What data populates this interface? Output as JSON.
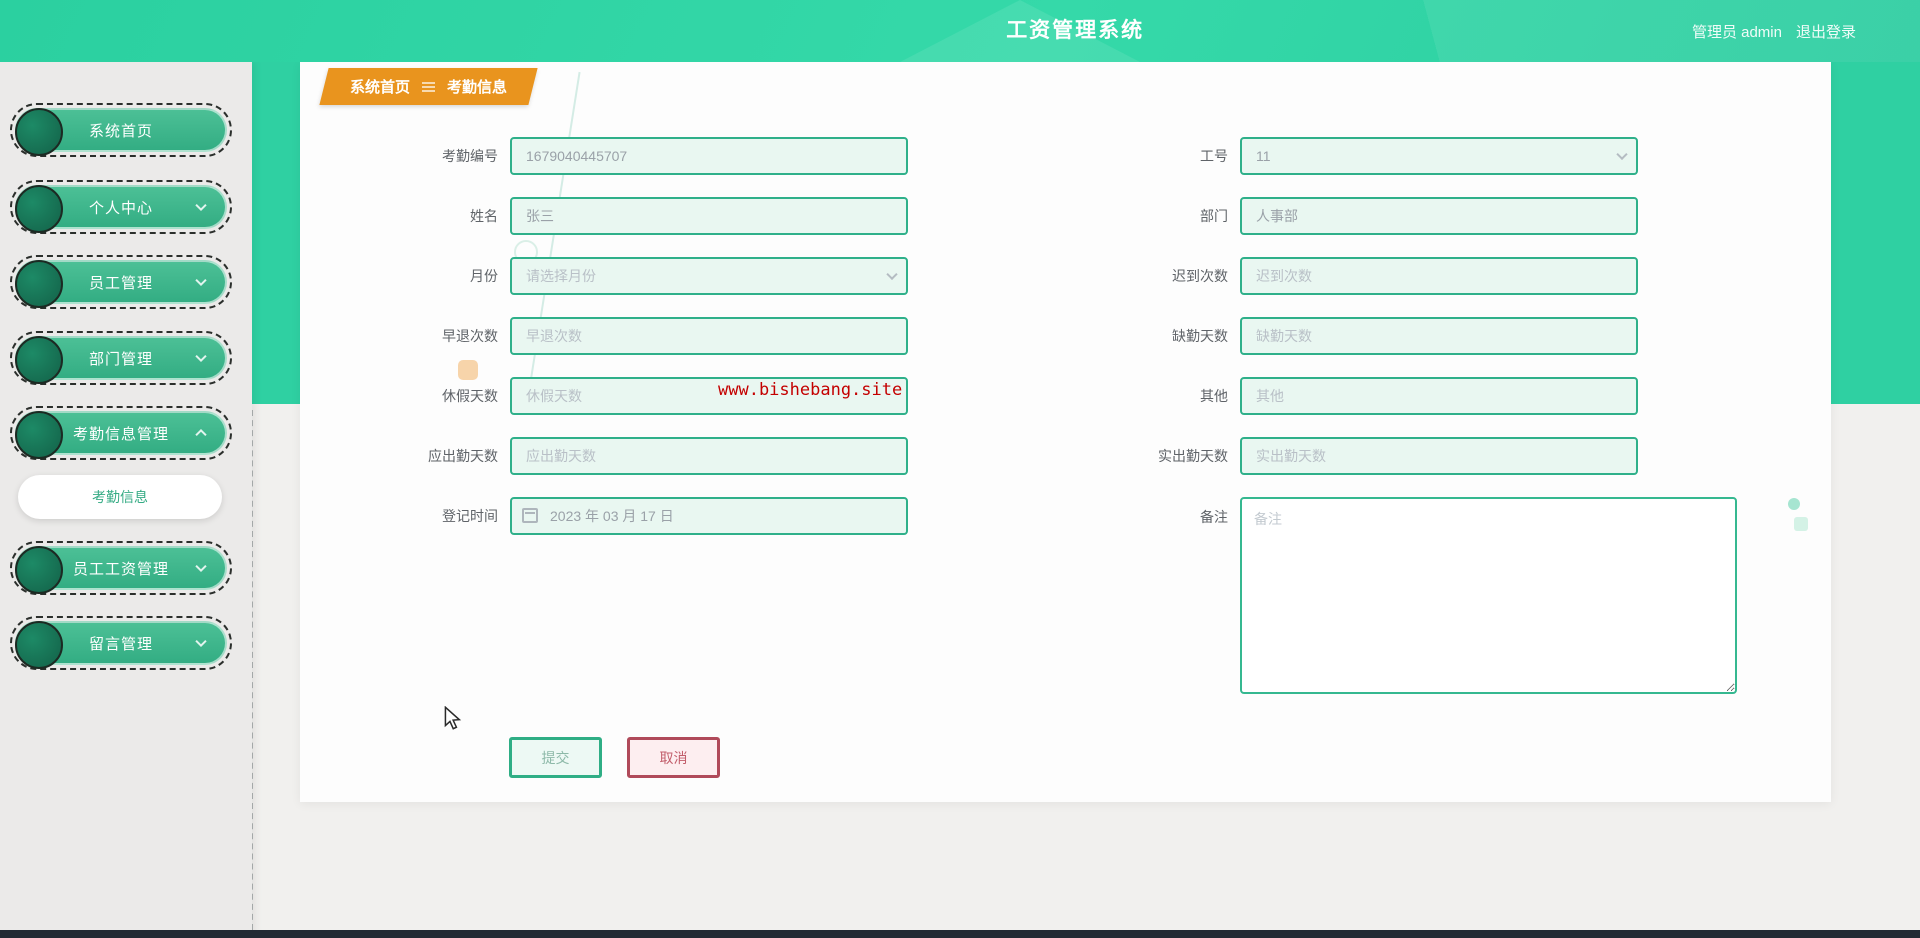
{
  "header": {
    "title": "工资管理系统",
    "user": "管理员 admin",
    "logout": "退出登录"
  },
  "sidebar": {
    "items": [
      {
        "label": "系统首页",
        "chevron": "none"
      },
      {
        "label": "个人中心",
        "chevron": "down"
      },
      {
        "label": "员工管理",
        "chevron": "down"
      },
      {
        "label": "部门管理",
        "chevron": "down"
      },
      {
        "label": "考勤信息管理",
        "chevron": "up",
        "expanded": true
      },
      {
        "label": "员工工资管理",
        "chevron": "down"
      },
      {
        "label": "留言管理",
        "chevron": "down"
      }
    ],
    "submenu": {
      "label": "考勤信息",
      "active": true
    }
  },
  "breadcrumb": {
    "home": "系统首页",
    "current": "考勤信息"
  },
  "form": {
    "left": [
      {
        "label": "考勤编号",
        "value": "1679040445707"
      },
      {
        "label": "姓名",
        "value": "张三"
      },
      {
        "label": "月份",
        "placeholder": "请选择月份",
        "type": "select"
      },
      {
        "label": "早退次数",
        "placeholder": "早退次数"
      },
      {
        "label": "休假天数",
        "placeholder": "休假天数"
      },
      {
        "label": "应出勤天数",
        "placeholder": "应出勤天数"
      },
      {
        "label": "登记时间",
        "value": "2023 年 03 月 17 日",
        "type": "date"
      }
    ],
    "right": [
      {
        "label": "工号",
        "value": "11",
        "type": "select"
      },
      {
        "label": "部门",
        "value": "人事部"
      },
      {
        "label": "迟到次数",
        "placeholder": "迟到次数"
      },
      {
        "label": "缺勤天数",
        "placeholder": "缺勤天数"
      },
      {
        "label": "其他",
        "placeholder": "其他"
      },
      {
        "label": "实出勤天数",
        "placeholder": "实出勤天数"
      }
    ],
    "remark": {
      "label": "备注",
      "placeholder": "备注"
    },
    "submit_label": "提交",
    "cancel_label": "取消"
  },
  "watermark": "www.bishebang.site",
  "colors": {
    "header_teal": "#2fd0a2",
    "pill_green": "#3cb389",
    "pill_circle": "#17795a",
    "breadcrumb_orange": "#e9941e",
    "input_border": "#2fb08a",
    "input_bg": "#e9f7f1",
    "cancel_red": "#b04a5a",
    "watermark_red": "#c40000",
    "sidebar_gray": "#ebeae9"
  }
}
